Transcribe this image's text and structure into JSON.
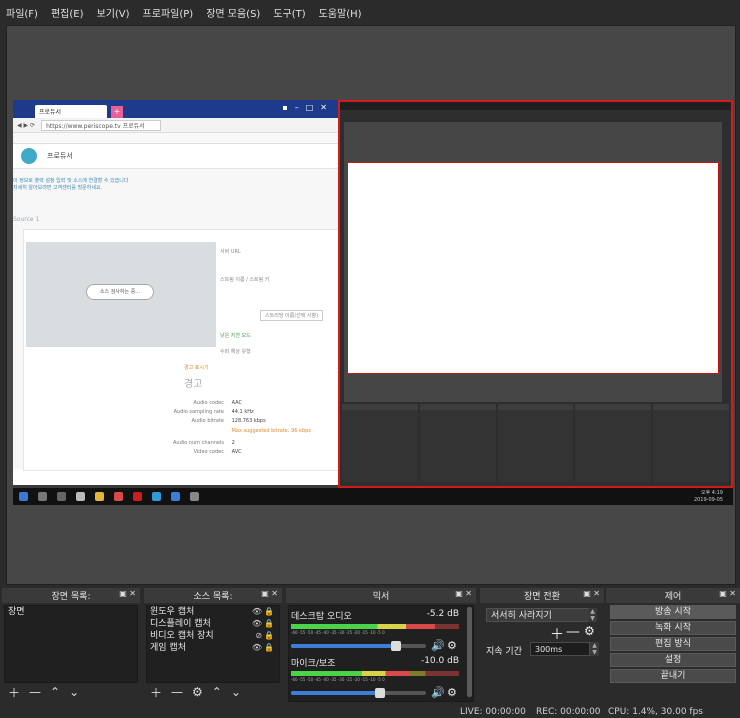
{
  "menu": [
    "파일(F)",
    "편집(E)",
    "보기(V)",
    "프로파일(P)",
    "장면 모음(S)",
    "도구(T)",
    "도움말(H)"
  ],
  "preview": {
    "browser": {
      "tab_title": "프로듀서",
      "url": "https://www.periscope.tv 프로듀서",
      "header_title": "프로듀서",
      "note_line1": "이 정보로 출력 설정 입력 및 소스에 연결할 수 있습니다",
      "note_line2": "자세히 알아보려면 고객센터를 방문하세요.",
      "source_label": "Source 1",
      "check_button": "소스 검사하는 중...",
      "server_url_label": "서버 URL",
      "stream_key_label": "스트림 이름 / 스트림 키",
      "reset_button": "스트리밍 이름(선택 사항)",
      "option1": "낮은 지연 모드",
      "option2": "수퍼 해상 유형",
      "warning_small": "경고 표시기",
      "warning_large": "경고",
      "stats": [
        {
          "label": "Audio codec",
          "value": "AAC"
        },
        {
          "label": "Audio sampling rate",
          "value": "44.1 kHz"
        },
        {
          "label": "Audio bitrate",
          "value": "128.763 kbps"
        },
        {
          "label": "",
          "value": "Max suggested bitrate: 96 kbps"
        },
        {
          "label": "Audio num channels",
          "value": "2"
        },
        {
          "label": "Video codec",
          "value": "AVC"
        }
      ]
    },
    "taskbar_time": "오후 4:19",
    "taskbar_date": "2019-09-05"
  },
  "docks": {
    "scenes": {
      "title": "장면 목록:",
      "items": [
        "장면"
      ]
    },
    "sources": {
      "title": "소스 목록:",
      "items": [
        "윈도우 캡처",
        "디스플레이 캡처",
        "비디오 캡처 장치",
        "게임 캡처"
      ]
    },
    "mixer": {
      "title": "믹서",
      "channels": [
        {
          "name": "데스크탑 오디오",
          "level": "-5.2 dB",
          "meter_fill": 0.86,
          "volume": 0.78
        },
        {
          "name": "마이크/보조",
          "level": "-10.0 dB",
          "meter_fill": 0.7,
          "volume": 0.66
        }
      ],
      "scale": "-60 -55 -50 -45 -40 -35 -30 -25 -20 -15 -10 -5 0"
    },
    "transitions": {
      "title": "장면 전환",
      "selected": "서서히 사라지기",
      "duration_label": "지속 기간",
      "duration_value": "300ms"
    },
    "controls": {
      "title": "제어",
      "buttons": [
        "방송 시작",
        "녹화 시작",
        "편집 방식",
        "설정",
        "끝내기"
      ]
    }
  },
  "status": {
    "live": "LIVE: 00:00:00",
    "rec": "REC: 00:00:00",
    "cpu": "CPU: 1.4%, 30.00 fps"
  }
}
